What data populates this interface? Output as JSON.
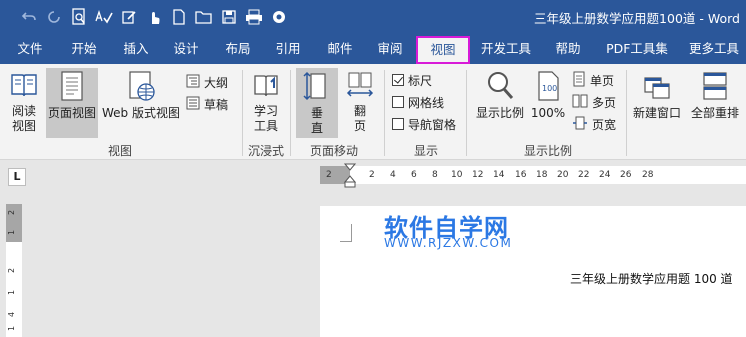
{
  "window": {
    "title": "三年级上册数学应用题100道  -  Word"
  },
  "qat": {
    "icons": [
      "undo-icon",
      "redo-icon",
      "print-preview-icon",
      "spell-check-icon",
      "edit-icon",
      "touch-mode-icon",
      "new-document-icon",
      "open-folder-icon",
      "save-icon",
      "print-icon",
      "customize-icon"
    ]
  },
  "tabs": [
    "文件",
    "开始",
    "插入",
    "设计",
    "布局",
    "引用",
    "邮件",
    "审阅",
    "视图",
    "开发工具",
    "帮助",
    "PDF工具集",
    "更多工具"
  ],
  "active_tab": "视图",
  "ribbon": {
    "views": {
      "read_mode_1": "阅读",
      "read_mode_2": "视图",
      "print_layout": "页面视图",
      "web_layout": "Web 版式视图",
      "outline": "大纲",
      "draft": "草稿",
      "label": "视图"
    },
    "immersive": {
      "learning_tools_1": "学习",
      "learning_tools_2": "工具",
      "label": "沉浸式"
    },
    "page_movement": {
      "vertical_1": "垂",
      "vertical_2": "直",
      "side_to_side_1": "翻",
      "side_to_side_2": "页",
      "label": "页面移动"
    },
    "show": {
      "ruler": "标尺",
      "ruler_checked": true,
      "gridlines": "网格线",
      "gridlines_checked": false,
      "nav_pane": "导航窗格",
      "nav_pane_checked": false,
      "label": "显示"
    },
    "zoom": {
      "zoom": "显示比例",
      "hundred": "100%",
      "one_page": "单页",
      "multiple_pages": "多页",
      "page_width": "页宽",
      "label": "显示比例"
    },
    "window": {
      "new_window": "新建窗口",
      "arrange_all": "全部重排"
    }
  },
  "ruler": {
    "corner": "L",
    "h_ticks": [
      "2",
      "2",
      "2",
      "4",
      "6",
      "8",
      "10",
      "12",
      "14",
      "16",
      "18",
      "20",
      "22",
      "24",
      "26",
      "28"
    ],
    "v_ticks": [
      "2",
      "1",
      "2",
      "1",
      "4",
      "1"
    ]
  },
  "document": {
    "watermark_cn": "软件自学网",
    "watermark_url": "WWW.RJZXW.COM",
    "body_text": "三年级上册数学应用题 100 道"
  },
  "colors": {
    "title_bar": "#2b579a",
    "active_tab_highlight": "#d81ad8",
    "ribbon_bg": "#f3f3f3",
    "watermark": "#2b78e4"
  }
}
